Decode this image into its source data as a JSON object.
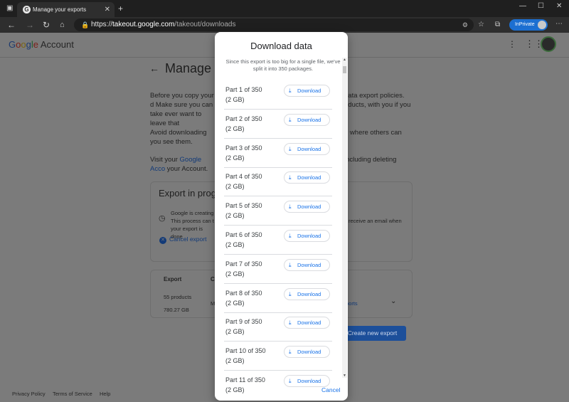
{
  "browser": {
    "tab_title": "Manage your exports",
    "tab_favicon": "G",
    "url_scheme": "https://",
    "url_host": "takeout.google.com",
    "url_path": "/takeout/downloads",
    "inprivate_label": "InPrivate"
  },
  "account_header": {
    "logo_google": "Google",
    "logo_account": "Account"
  },
  "page": {
    "title": "Manage yo",
    "intro_left": "Before you copy your d Make sure you can take ever want to leave that",
    "intro_right": "data export policies. oducts, with you if you",
    "avoid_left": "Avoid downloading you see them.",
    "avoid_right": "n where others can",
    "visit_prefix": "Visit your ",
    "visit_link": "Google Acco",
    "visit_suffix": " your Account.",
    "visit_right": "including deleting",
    "export_card_title": "Export in prog",
    "export_notice_left": "Google is creating This process can t your export is done",
    "export_notice_right": "receive an email when",
    "cancel_export": "Cancel export",
    "table_header_export": "Export",
    "table_header_c": "C",
    "row_products": "55 products",
    "row_size": "780.27 GB",
    "row_m": "M",
    "row_reports": "ports",
    "create_new_export": "Create new export"
  },
  "footer": {
    "privacy": "Privacy Policy",
    "terms": "Terms of Service",
    "help": "Help"
  },
  "dialog": {
    "title": "Download data",
    "description": "Since this export is too big for a single file, we've split it into 350 packages.",
    "download_label": "Download",
    "cancel_label": "Cancel",
    "parts": [
      {
        "label": "Part 1 of 350",
        "size": "(2 GB)"
      },
      {
        "label": "Part 2 of 350",
        "size": "(2 GB)"
      },
      {
        "label": "Part 3 of 350",
        "size": "(2 GB)"
      },
      {
        "label": "Part 4 of 350",
        "size": "(2 GB)"
      },
      {
        "label": "Part 5 of 350",
        "size": "(2 GB)"
      },
      {
        "label": "Part 6 of 350",
        "size": "(2 GB)"
      },
      {
        "label": "Part 7 of 350",
        "size": "(2 GB)"
      },
      {
        "label": "Part 8 of 350",
        "size": "(2 GB)"
      },
      {
        "label": "Part 9 of 350",
        "size": "(2 GB)"
      },
      {
        "label": "Part 10 of 350",
        "size": "(2 GB)"
      },
      {
        "label": "Part 11 of 350",
        "size": "(2 GB)"
      }
    ]
  },
  "icons": {
    "download": "download-icon",
    "back": "back-arrow-icon",
    "clock": "clock-icon",
    "cancel": "cancel-circle-icon"
  }
}
